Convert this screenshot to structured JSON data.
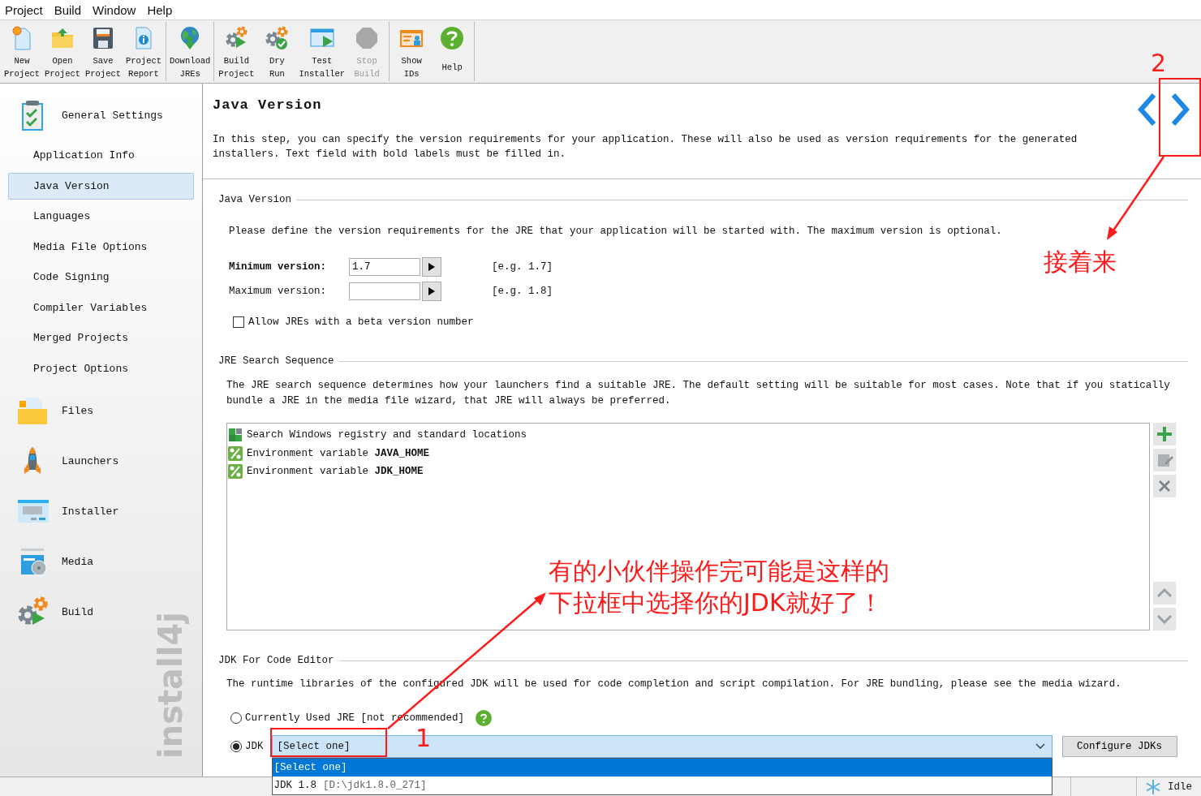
{
  "menu": [
    "Project",
    "Build",
    "Window",
    "Help"
  ],
  "toolbar": [
    [
      {
        "lines": [
          "New",
          "Project"
        ],
        "disabled": false
      },
      {
        "lines": [
          "Open",
          "Project"
        ],
        "disabled": false
      },
      {
        "lines": [
          "Save",
          "Project"
        ],
        "disabled": false
      },
      {
        "lines": [
          "Project",
          "Report"
        ],
        "disabled": false
      }
    ],
    [
      {
        "lines": [
          "Download",
          "JREs"
        ],
        "disabled": false
      }
    ],
    [
      {
        "lines": [
          "Build",
          "Project"
        ],
        "disabled": false
      },
      {
        "lines": [
          "Dry",
          "Run"
        ],
        "disabled": false
      },
      {
        "lines": [
          "Test",
          "Installer"
        ],
        "disabled": false
      },
      {
        "lines": [
          "Stop",
          "Build"
        ],
        "disabled": true
      }
    ],
    [
      {
        "lines": [
          "Show",
          "IDs"
        ],
        "disabled": false
      },
      {
        "lines": [
          "Help"
        ],
        "disabled": false
      }
    ]
  ],
  "sidebar": {
    "brand": "install4j",
    "sections": [
      {
        "label": "General Settings",
        "selected": false,
        "children": [
          {
            "label": "Application Info",
            "selected": false
          },
          {
            "label": "Java Version",
            "selected": true
          },
          {
            "label": "Languages",
            "selected": false
          },
          {
            "label": "Media File Options",
            "selected": false
          },
          {
            "label": "Code Signing",
            "selected": false
          },
          {
            "label": "Compiler Variables",
            "selected": false
          },
          {
            "label": "Merged Projects",
            "selected": false
          },
          {
            "label": "Project Options",
            "selected": false
          }
        ]
      },
      {
        "label": "Files",
        "selected": false
      },
      {
        "label": "Launchers",
        "selected": false
      },
      {
        "label": "Installer",
        "selected": false
      },
      {
        "label": "Media",
        "selected": false
      },
      {
        "label": "Build",
        "selected": false
      }
    ]
  },
  "header": {
    "title": "Java Version",
    "description": "In this step, you can specify the version requirements for your application. These will also be used as version requirements for the generated installers. Text field with bold labels must be filled in."
  },
  "java_version": {
    "title": "Java Version",
    "intro": "Please define the version requirements for the JRE that your application will be started with. The maximum version is optional.",
    "fields": [
      {
        "label": "Minimum version:",
        "required": true,
        "value": "1.7",
        "hint": "[e.g. 1.7]"
      },
      {
        "label": "Maximum version:",
        "required": false,
        "hint": "[e.g. 1.8]"
      }
    ],
    "beta_checkbox": {
      "label": "Allow JREs with a beta version number",
      "checked": false
    }
  },
  "jre_search": {
    "title": "JRE Search Sequence",
    "description": "The JRE search sequence determines how your launchers find a suitable JRE. The default setting will be suitable for most cases. Note that if you statically bundle a JRE in the media file wizard, that JRE will always be preferred.",
    "entries": [
      {
        "kind": "registry",
        "text": "Search Windows registry and standard locations"
      },
      {
        "kind": "env",
        "text": "Environment variable **JAVA_HOME**"
      },
      {
        "kind": "env",
        "text": "Environment variable **JDK_HOME**"
      }
    ]
  },
  "jdk": {
    "title": "JDK For Code Editor",
    "description": "The runtime libraries of the configured JDK will be used for code completion and script compilation. For JRE bundling, please see the media wizard.",
    "options": [
      {
        "label": "Currently Used JRE [not recommended]",
        "selected": false
      },
      {
        "label": "JDK",
        "selected": true
      }
    ],
    "combo_value": "[Select one]",
    "dropdown": [
      {
        "text": "[Select one]",
        "selected": true
      },
      {
        "text": "JDK 1.8",
        "path": "[D:\\jdk1.8.0_271]",
        "selected": false
      }
    ],
    "configure_button": "Configure JDKs"
  },
  "status_bar": {
    "text": "Idle"
  },
  "annotations": [
    {
      "lines": [
        "2"
      ]
    },
    {
      "lines": [
        "接着来"
      ]
    },
    {
      "lines": [
        "有的小伙伴操作完可能是这样的",
        "下拉框中选择你的JDK就好了！"
      ]
    },
    {
      "lines": [
        "1"
      ]
    }
  ]
}
